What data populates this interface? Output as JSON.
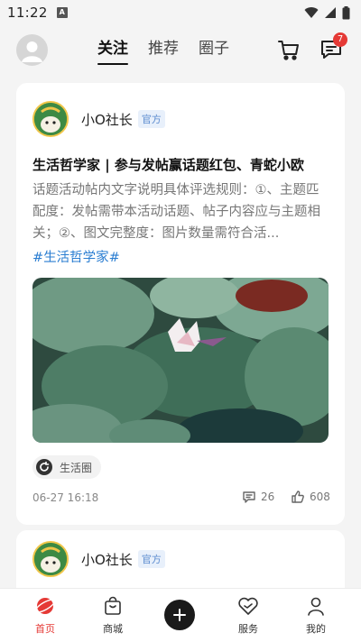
{
  "status_bar": {
    "time": "11:22",
    "notification_glyph": "A"
  },
  "header": {
    "tabs": [
      {
        "label": "关注",
        "active": true
      },
      {
        "label": "推荐",
        "active": false
      },
      {
        "label": "圈子",
        "active": false
      }
    ],
    "message_badge": "7"
  },
  "posts": [
    {
      "author": "小O社长",
      "badge": "官方",
      "title": "生活哲学家 | 参与发帖赢话题红包、青蛇小欧",
      "body": "话题活动帖内文字说明具体评选规则：①、主题匹配度：发帖需带本活动话题、帖子内容应与主题相关；②、图文完整度：图片数量需符合活...",
      "tag": "#生活哲学家#",
      "circle": "生活圈",
      "time": "06-27 16:18",
      "comments": "26",
      "likes": "608"
    },
    {
      "author": "小O社长",
      "badge": "官方"
    }
  ],
  "bottom_nav": [
    {
      "label": "首页",
      "icon": "home-planet-icon",
      "active": true
    },
    {
      "label": "商城",
      "icon": "shopping-bag-icon",
      "active": false
    },
    {
      "label": "",
      "icon": "plus-icon",
      "active": false
    },
    {
      "label": "服务",
      "icon": "heart-service-icon",
      "active": false
    },
    {
      "label": "我的",
      "icon": "person-icon",
      "active": false
    }
  ],
  "colors": {
    "accent": "#e53935",
    "link": "#2a7dd1",
    "official": "#5c8ccf"
  }
}
